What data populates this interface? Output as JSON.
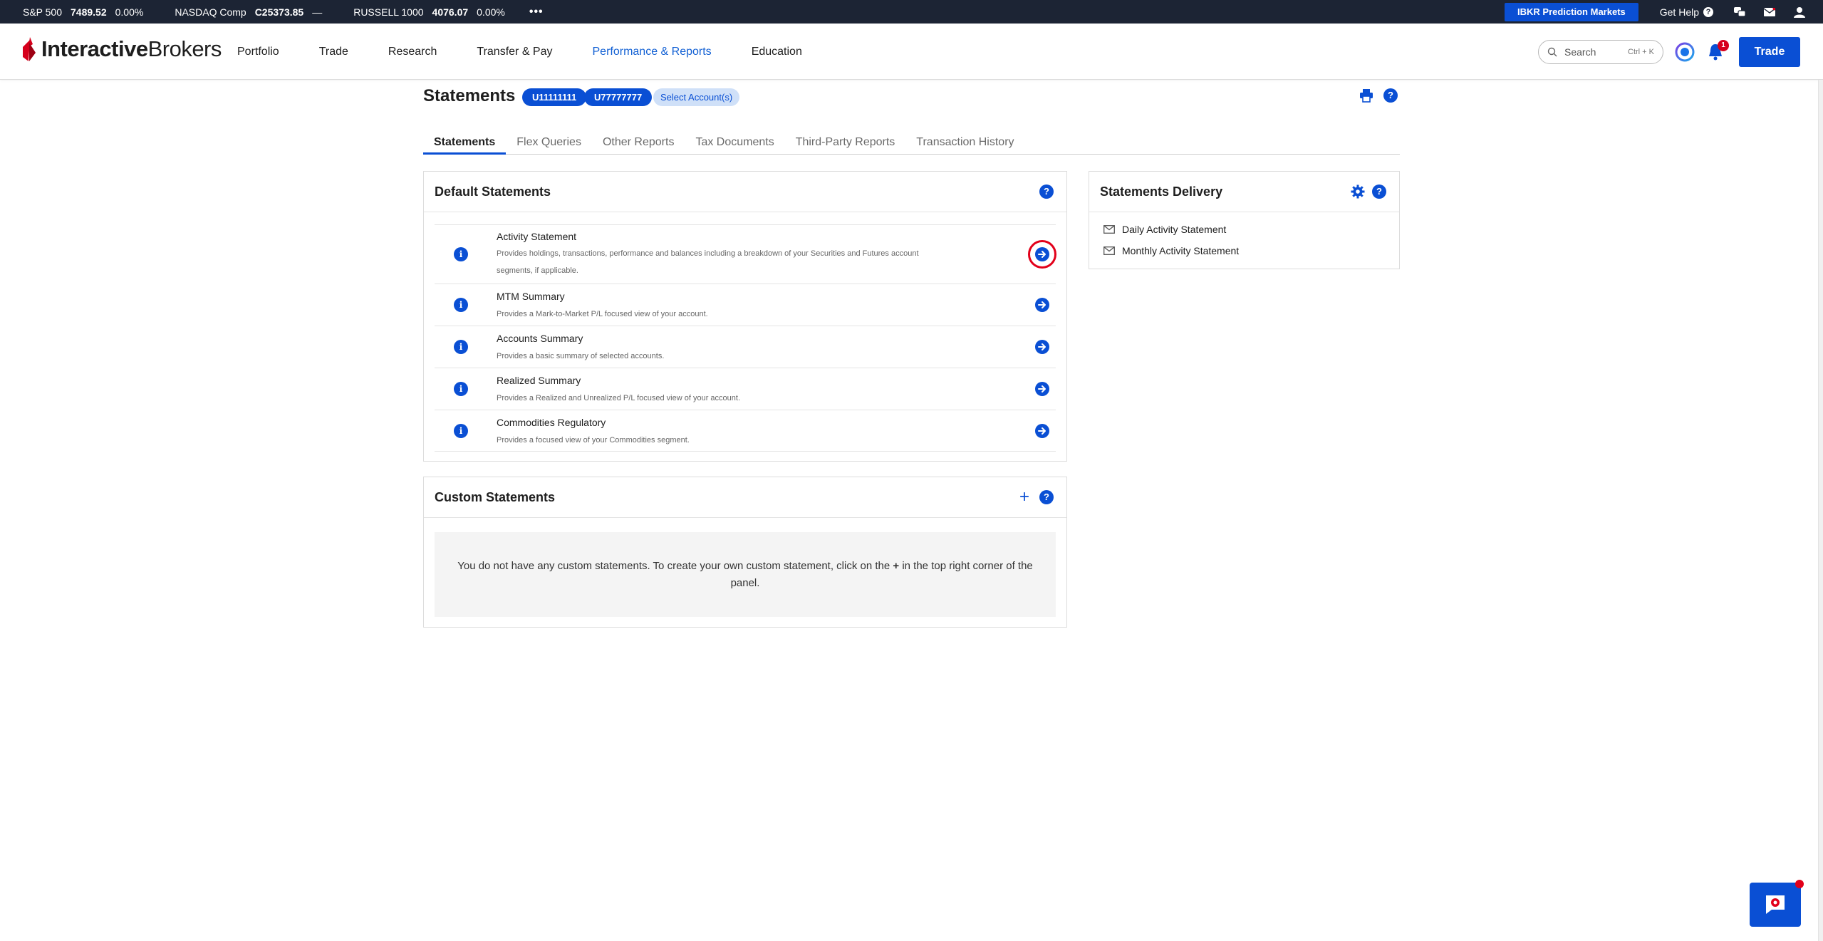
{
  "ticker": {
    "items": [
      {
        "name": "S&P 500",
        "value": "7489.52",
        "change": "0.00%"
      },
      {
        "name": "NASDAQ Comp",
        "value": "C25373.85",
        "change": "—"
      },
      {
        "name": "RUSSELL 1000",
        "value": "4076.07",
        "change": "0.00%"
      }
    ],
    "more": "•••",
    "prediction_markets": "IBKR Prediction Markets",
    "get_help": "Get Help"
  },
  "nav": {
    "logo_bold": "Interactive",
    "logo_rest": "Brokers",
    "items": [
      "Portfolio",
      "Trade",
      "Research",
      "Transfer & Pay",
      "Performance & Reports",
      "Education"
    ],
    "active_index": 4,
    "search_placeholder": "Search",
    "search_shortcut": "Ctrl + K",
    "notification_count": "1",
    "trade_label": "Trade"
  },
  "page": {
    "title": "Statements",
    "accounts": [
      "U11111111",
      "U77777777"
    ],
    "select_accounts": "Select Account(s)"
  },
  "tabs": [
    "Statements",
    "Flex Queries",
    "Other Reports",
    "Tax Documents",
    "Third-Party Reports",
    "Transaction History"
  ],
  "default_statements": {
    "title": "Default Statements",
    "items": [
      {
        "name": "Activity Statement",
        "desc": "Provides holdings, transactions, performance and balances including a breakdown of your Securities and Futures account segments, if applicable."
      },
      {
        "name": "MTM Summary",
        "desc": "Provides a Mark-to-Market P/L focused view of your account."
      },
      {
        "name": "Accounts Summary",
        "desc": "Provides a basic summary of selected accounts."
      },
      {
        "name": "Realized Summary",
        "desc": "Provides a Realized and Unrealized P/L focused view of your account."
      },
      {
        "name": "Commodities Regulatory",
        "desc": "Provides a focused view of your Commodities segment."
      }
    ]
  },
  "custom_statements": {
    "title": "Custom Statements",
    "empty_before": "You do not have any custom statements. To create your own custom statement, click on the",
    "empty_plus": "+",
    "empty_after": "in the top right corner of the panel."
  },
  "statements_delivery": {
    "title": "Statements Delivery",
    "items": [
      "Daily Activity Statement",
      "Monthly Activity Statement"
    ]
  },
  "colors": {
    "brand_blue": "#0a4fd4",
    "ticker_bg": "#1c2434",
    "alert_red": "#e2001a"
  }
}
